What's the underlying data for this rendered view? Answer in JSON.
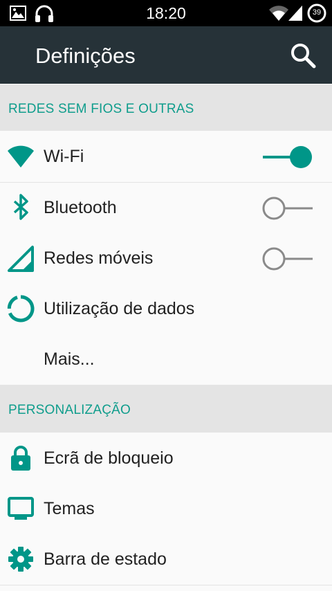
{
  "status_bar": {
    "time": "18:20",
    "battery_level": "39",
    "icons": [
      "image-icon",
      "headset-icon",
      "wifi-signal-icon",
      "cell-signal-icon",
      "battery-icon"
    ]
  },
  "app_bar": {
    "title": "Definições",
    "search_icon": "search-icon"
  },
  "sections": [
    {
      "title": "REDES SEM FIOS E OUTRAS",
      "items": [
        {
          "label": "Wi-Fi",
          "icon": "wifi-icon",
          "toggle": true,
          "toggle_on": true
        },
        {
          "label": "Bluetooth",
          "icon": "bluetooth-icon",
          "toggle": true,
          "toggle_on": false
        },
        {
          "label": "Redes móveis",
          "icon": "cell-signal-icon",
          "toggle": true,
          "toggle_on": false
        },
        {
          "label": "Utilização de dados",
          "icon": "data-usage-icon",
          "toggle": false
        },
        {
          "label": "Mais...",
          "icon": "",
          "toggle": false
        }
      ]
    },
    {
      "title": "PERSONALIZAÇÃO",
      "items": [
        {
          "label": "Ecrã de bloqueio",
          "icon": "lock-icon",
          "toggle": false
        },
        {
          "label": "Temas",
          "icon": "monitor-icon",
          "toggle": false
        },
        {
          "label": "Barra de estado",
          "icon": "gear-icon",
          "toggle": false
        }
      ]
    }
  ],
  "colors": {
    "accent": "#009688",
    "section_text": "#0f9d8c",
    "app_bar": "#263238",
    "section_bg": "#e4e4e4"
  }
}
